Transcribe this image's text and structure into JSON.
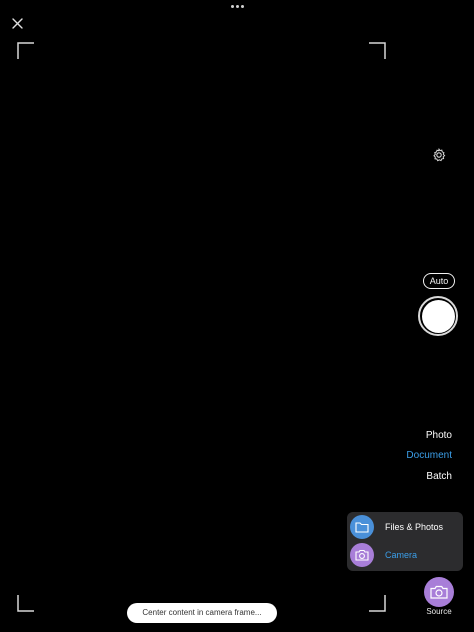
{
  "top_bar": {
    "more_icon": "more-dots-icon",
    "close_icon": "close-icon"
  },
  "camera_frame": {
    "corner_color": "#d8d8d8"
  },
  "controls": {
    "settings_icon": "gear-icon",
    "flash_mode_label": "Auto",
    "shutter_icon": "shutter-icon"
  },
  "capture_modes": [
    {
      "label": "Photo",
      "active": false
    },
    {
      "label": "Document",
      "active": true
    },
    {
      "label": "Batch",
      "active": false
    }
  ],
  "source_menu": {
    "items": [
      {
        "label": "Files & Photos",
        "icon": "folder-icon",
        "color": "#4a90d9",
        "text_color": "#ffffff"
      },
      {
        "label": "Camera",
        "icon": "camera-icon",
        "color": "#a87ed8",
        "text_color": "#3b9ee8"
      }
    ]
  },
  "source_button": {
    "label": "Source",
    "icon": "camera-icon"
  },
  "hint": {
    "text": "Center content in camera frame..."
  },
  "colors": {
    "accent": "#3b9ee8",
    "files_icon_bg": "#4a90d9",
    "camera_icon_bg": "#a87ed8",
    "menu_bg": "#2c2c2e"
  }
}
